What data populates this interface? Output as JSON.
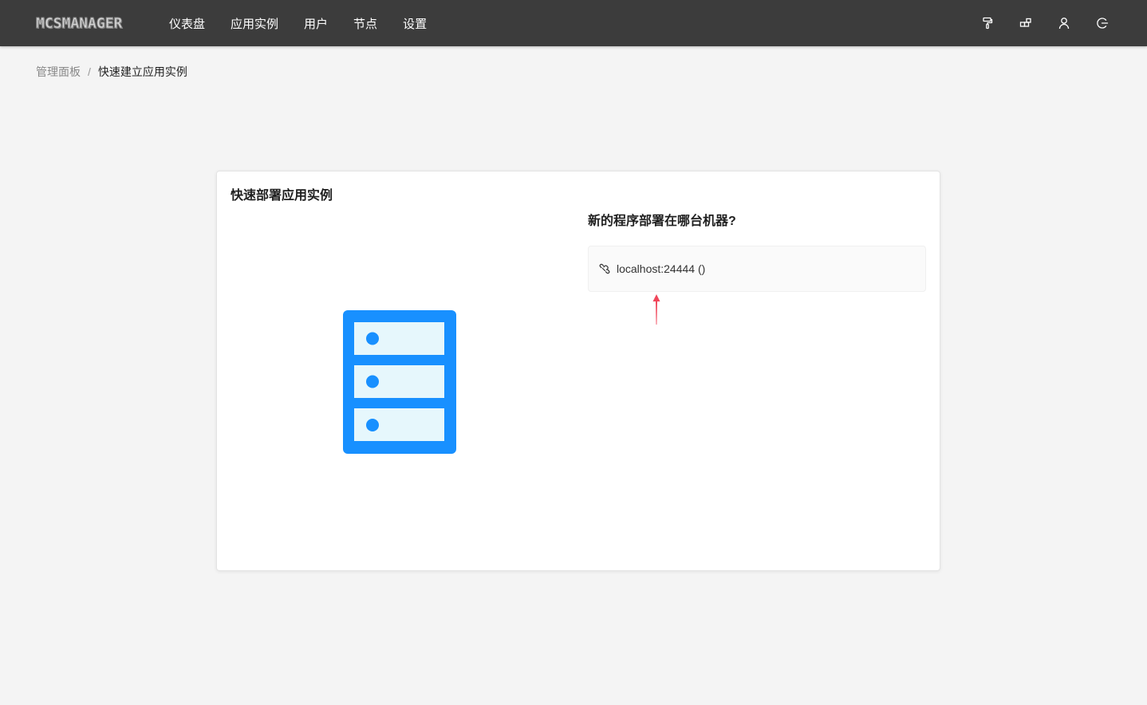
{
  "header": {
    "logo_text": "MCSMANAGER",
    "nav": [
      {
        "label": "仪表盘"
      },
      {
        "label": "应用实例"
      },
      {
        "label": "用户"
      },
      {
        "label": "节点"
      },
      {
        "label": "设置"
      }
    ],
    "icons": [
      "paint-roller-icon",
      "blocks-icon",
      "user-icon",
      "logout-icon"
    ]
  },
  "breadcrumb": {
    "parent": "管理面板",
    "separator": "/",
    "current": "快速建立应用实例"
  },
  "card": {
    "title": "快速部署应用实例",
    "question": "新的程序部署在哪台机器?",
    "nodes": [
      {
        "label": "localhost:24444 ()",
        "icon": "link-icon"
      }
    ]
  },
  "colors": {
    "topbar": "#3c3c3c",
    "accent": "#1890ff",
    "arrow": "#f0465a"
  }
}
